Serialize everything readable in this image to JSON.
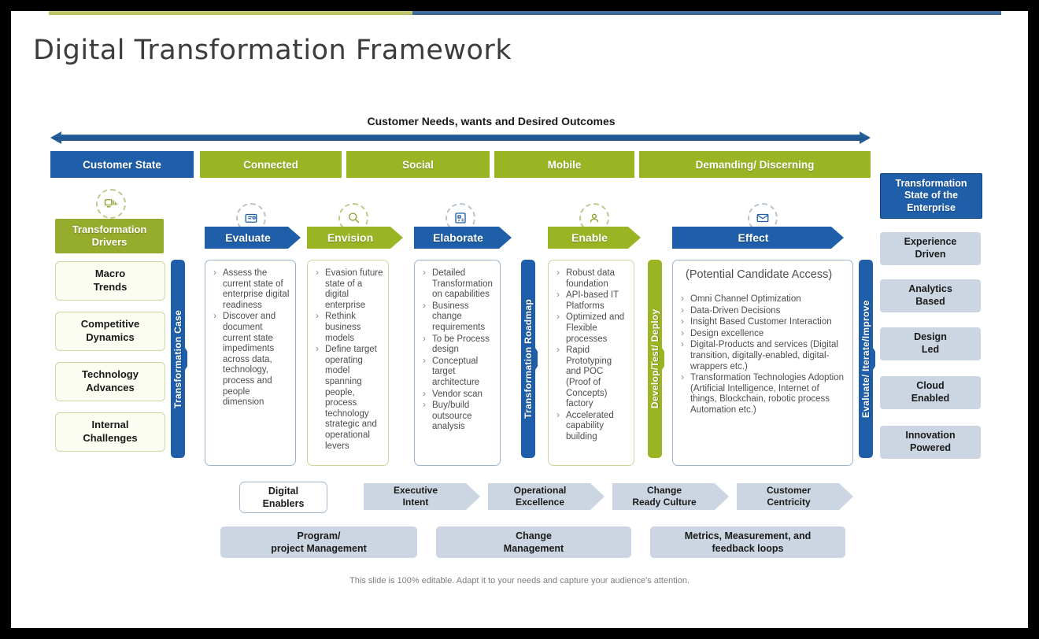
{
  "slide": {
    "title": "Digital Transformation Framework",
    "footer_note": "This slide is 100% editable. Adapt it to your needs and capture your audience's attention."
  },
  "top_banner": {
    "heading": "Customer Needs, wants and Desired Outcomes"
  },
  "customer_state_row": {
    "cells": [
      {
        "label": "Customer State",
        "color": "#1f5ea8"
      },
      {
        "label": "Connected",
        "color": "#9ab524"
      },
      {
        "label": "Social",
        "color": "#9ab524"
      },
      {
        "label": "Mobile",
        "color": "#9ab524"
      },
      {
        "label": "Demanding/ Discerning",
        "color": "#9ab524"
      }
    ]
  },
  "drivers": {
    "header": "Transformation Drivers",
    "header_line1": "Transformation",
    "header_line2": "Drivers",
    "items": [
      {
        "line1": "Macro",
        "line2": "Trends"
      },
      {
        "line1": "Competitive",
        "line2": "Dynamics"
      },
      {
        "line1": "Technology",
        "line2": "Advances"
      },
      {
        "line1": "Internal",
        "line2": "Challenges"
      }
    ]
  },
  "connectors": [
    {
      "label": "Transformation Case",
      "color": "#1f5ea8"
    },
    {
      "label": "Transformation Roadmap",
      "color": "#1f5ea8"
    },
    {
      "label": "Develop/Test/ Deploy",
      "color": "#9ab524"
    },
    {
      "label": "Evaluate/ Iterate/Improve",
      "color": "#1f5ea8"
    }
  ],
  "stages": [
    {
      "label": "Evaluate",
      "color": "#1f5ea8",
      "icon": "document-scan-icon",
      "bullets": [
        "Assess the current state of enterprise digital readiness",
        "Discover and document current state impediments across data, technology, process and people dimension"
      ]
    },
    {
      "label": "Envision",
      "color": "#9ab524",
      "icon": "lightbulb-search-icon",
      "bullets": [
        "Evasion future state of a digital enterprise",
        "Rethink business models",
        "Define target operating model spanning people, process technology strategic and operational levers"
      ]
    },
    {
      "label": "Elaborate",
      "color": "#1f5ea8",
      "icon": "blueprint-icon",
      "bullets": [
        "Detailed Transformation on capabilities",
        "Business change requirements",
        "To be Process design",
        "Conceptual target architecture",
        "Vendor scan",
        "Buy/build outsource analysis"
      ]
    },
    {
      "label": "Enable",
      "color": "#9ab524",
      "icon": "gear-person-icon",
      "bullets": [
        "Robust data foundation",
        "API-based IT Platforms",
        "Optimized and Flexible processes",
        "Rapid Prototyping and POC (Proof of Concepts) factory",
        "Accelerated capability building"
      ]
    },
    {
      "label": "Effect",
      "color": "#1f5ea8",
      "icon": "chart-mail-icon",
      "title": "(Potential Candidate Access)",
      "bullets": [
        "Omni Channel Optimization",
        "Data-Driven Decisions",
        "Insight Based Customer Interaction",
        "Design excellence",
        "Digital-Products and services (Digital transition, digitally-enabled, digital-wrappers etc.)",
        "Transformation Technologies Adoption (Artificial Intelligence, Internet of things, Blockchain, robotic process Automation etc.)"
      ]
    }
  ],
  "enterprise_state": {
    "header_line1": "Transformation",
    "header_line2": "State of the",
    "header_line3": "Enterprise",
    "items": [
      {
        "line1": "Experience",
        "line2": "Driven"
      },
      {
        "line1": "Analytics",
        "line2": "Based"
      },
      {
        "line1": "Design",
        "line2": "Led"
      },
      {
        "line1": "Cloud",
        "line2": "Enabled"
      },
      {
        "line1": "Innovation",
        "line2": "Powered"
      }
    ]
  },
  "enablers": {
    "box_line1": "Digital",
    "box_line2": "Enablers",
    "chevrons": [
      {
        "line1": "Executive",
        "line2": "Intent"
      },
      {
        "line1": "Operational",
        "line2": "Excellence"
      },
      {
        "line1": "Change",
        "line2": "Ready Culture"
      },
      {
        "line1": "Customer",
        "line2": "Centricity"
      }
    ]
  },
  "bottom_boxes": [
    {
      "line1": "Program/",
      "line2": "project Management"
    },
    {
      "line1": "Change",
      "line2": "Management"
    },
    {
      "line1": "Metrics, Measurement, and",
      "line2": "feedback loops"
    }
  ]
}
